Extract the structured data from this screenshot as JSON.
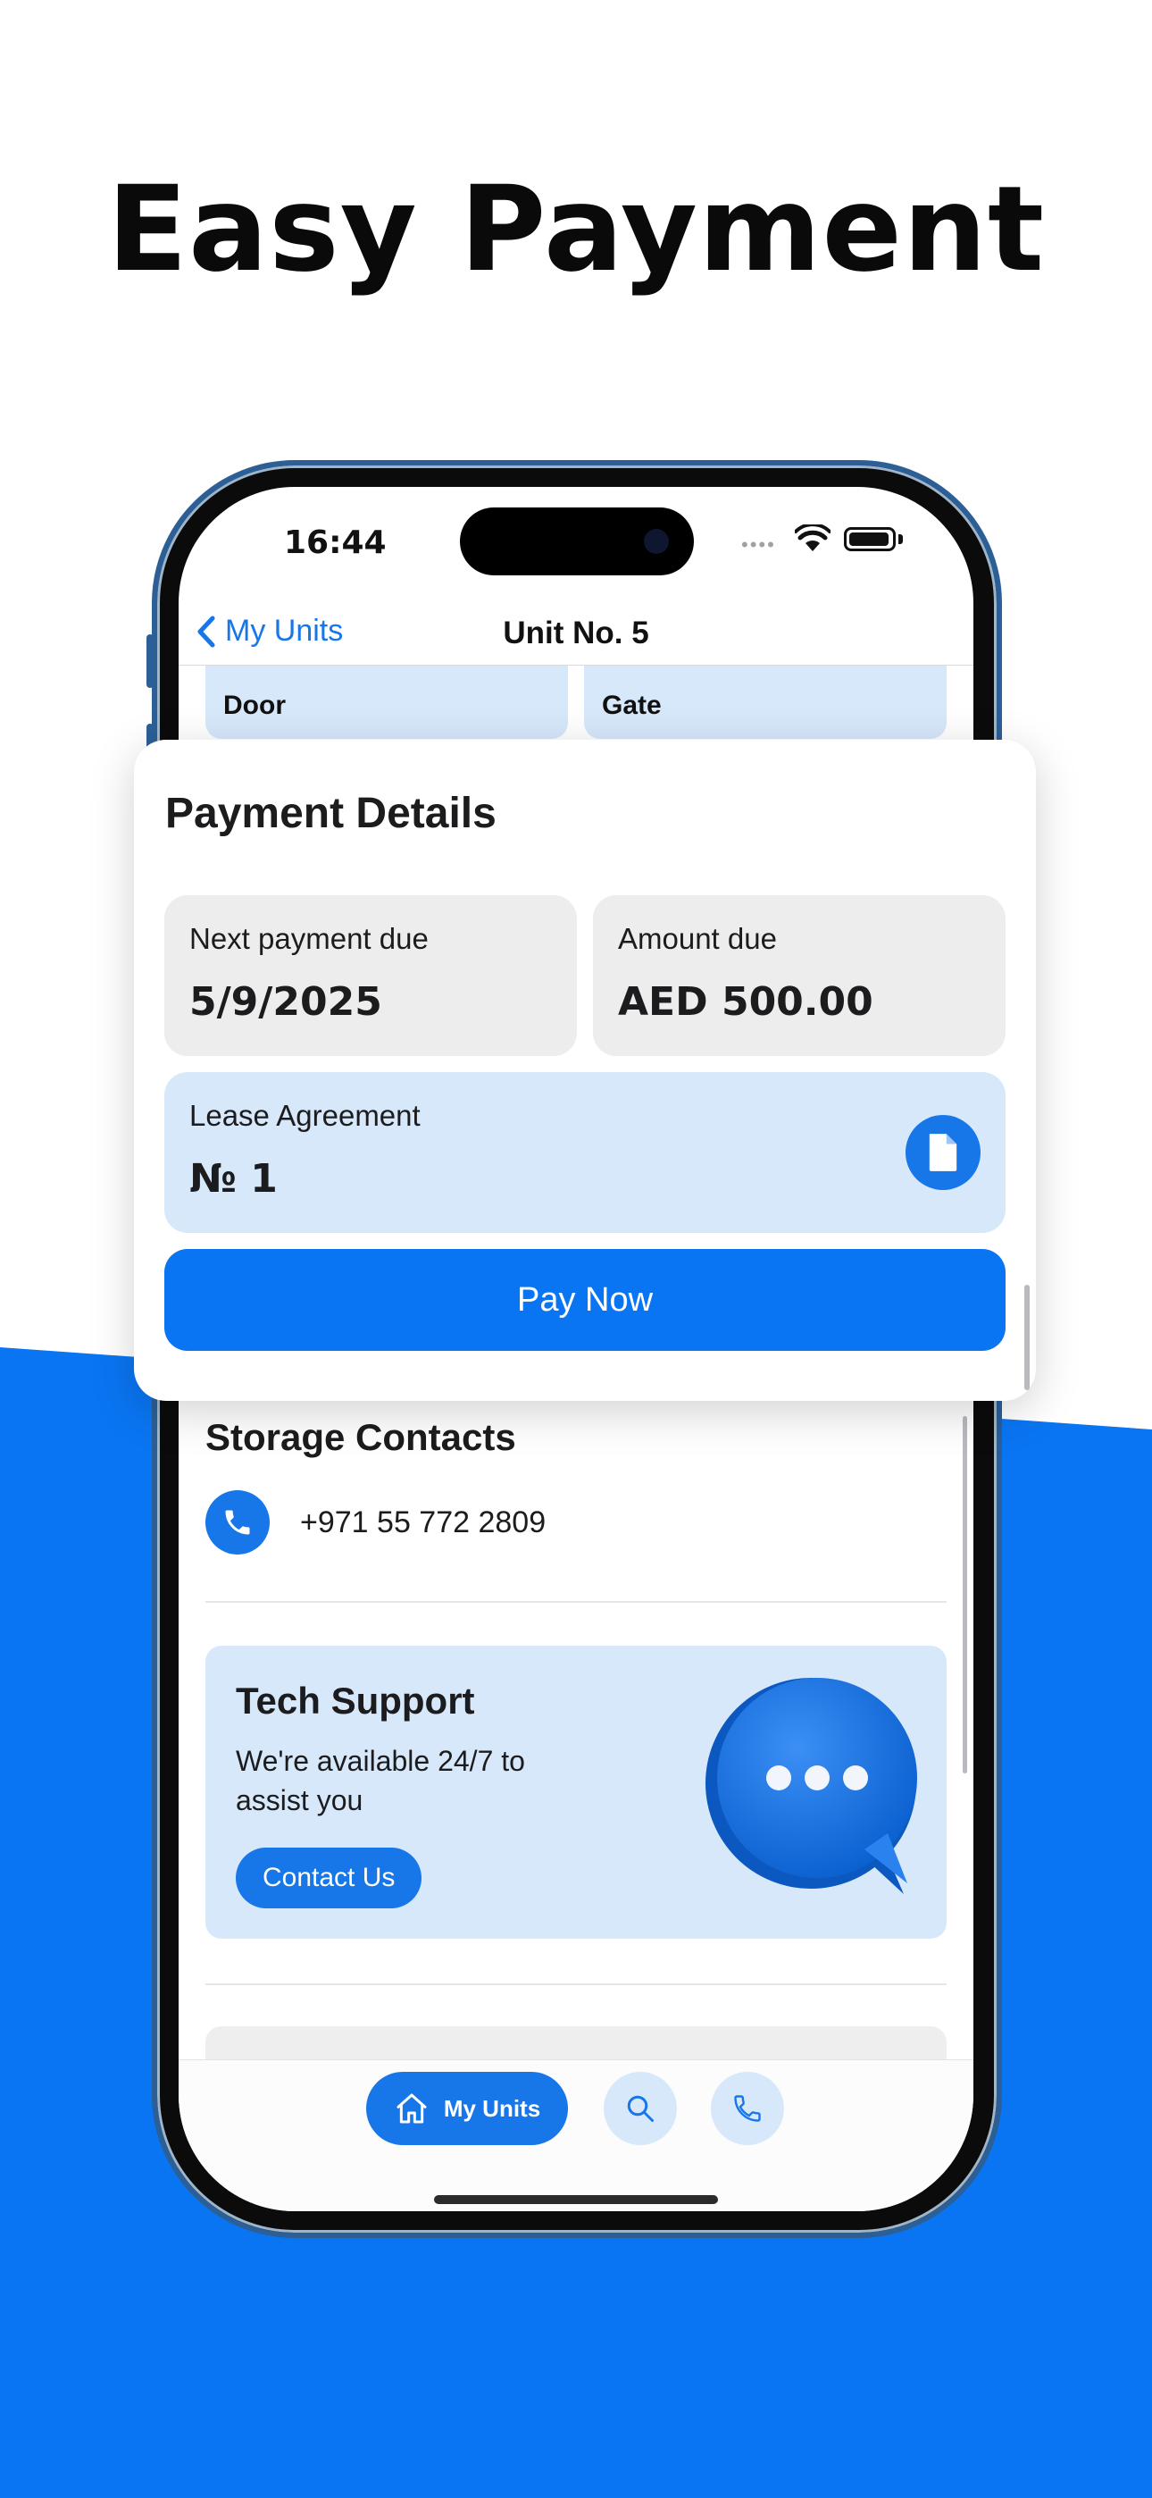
{
  "headline": "Easy Payment",
  "colors": {
    "brand": "#0A75F2",
    "tint": "#D7E8FB",
    "card_grey": "#EDEDEE"
  },
  "status_bar": {
    "time": "16:44"
  },
  "nav": {
    "back_label": "My Units",
    "title": "Unit No. 5"
  },
  "tiles": [
    {
      "label": "Door"
    },
    {
      "label": "Gate"
    }
  ],
  "payment_card": {
    "title": "Payment Details",
    "next_payment_label": "Next payment due",
    "next_payment_value": "5/9/2025",
    "amount_label": "Amount due",
    "amount_value": "AED 500.00",
    "lease_label": "Lease Agreement",
    "lease_value": "№ 1",
    "pay_button": "Pay Now"
  },
  "storage_contacts": {
    "title": "Storage Contacts",
    "phone": "+971 55 772 2809"
  },
  "tech_support": {
    "title": "Tech Support",
    "text": "We're available 24/7 to assist you",
    "button": "Contact Us"
  },
  "tabbar": {
    "my_units": "My Units",
    "icons": [
      "home-icon",
      "search-icon",
      "phone-icon"
    ]
  }
}
